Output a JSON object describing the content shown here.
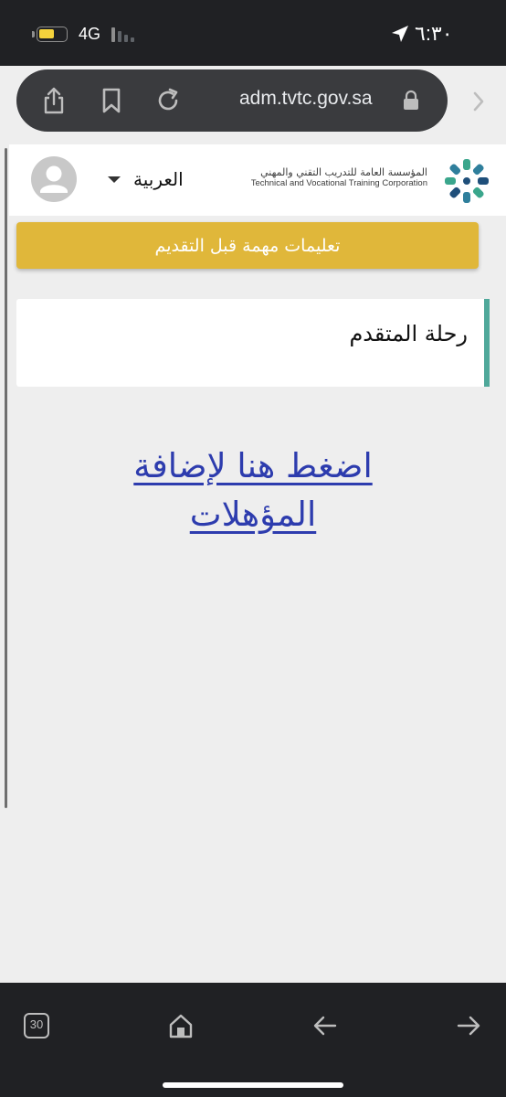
{
  "status_bar": {
    "time": "٦:٣٠",
    "network": "4G",
    "battery_level": 0.6,
    "battery_color": "#f5d33c",
    "icons": [
      "battery-icon",
      "signal-icon",
      "location-arrow-icon"
    ]
  },
  "browser": {
    "url": "adm.tvtc.gov.sa",
    "toolbar_icons": [
      "share-icon",
      "bookmark-icon",
      "reload-icon",
      "lock-icon",
      "chevron-right-icon"
    ],
    "tab_count": "30",
    "bottom_icons": [
      "tabs-icon",
      "home-icon",
      "back-arrow-icon",
      "forward-arrow-icon"
    ]
  },
  "header": {
    "language": "العربية",
    "org_name_ar": "المؤسسة العامة للتدريب التقني والمهني",
    "org_name_en": "Technical and Vocational Training Corporation"
  },
  "main": {
    "instructions_button": "تعليمات مهمة قبل التقديم",
    "journey_title": "رحلة المتقدم",
    "add_qualifications_link": "اضغط هنا لإضافة المؤهلات"
  },
  "colors": {
    "accent_yellow": "#e0b73a",
    "card_accent": "#4fa89a",
    "link": "#2d3cae",
    "chrome_dark": "#202124"
  }
}
